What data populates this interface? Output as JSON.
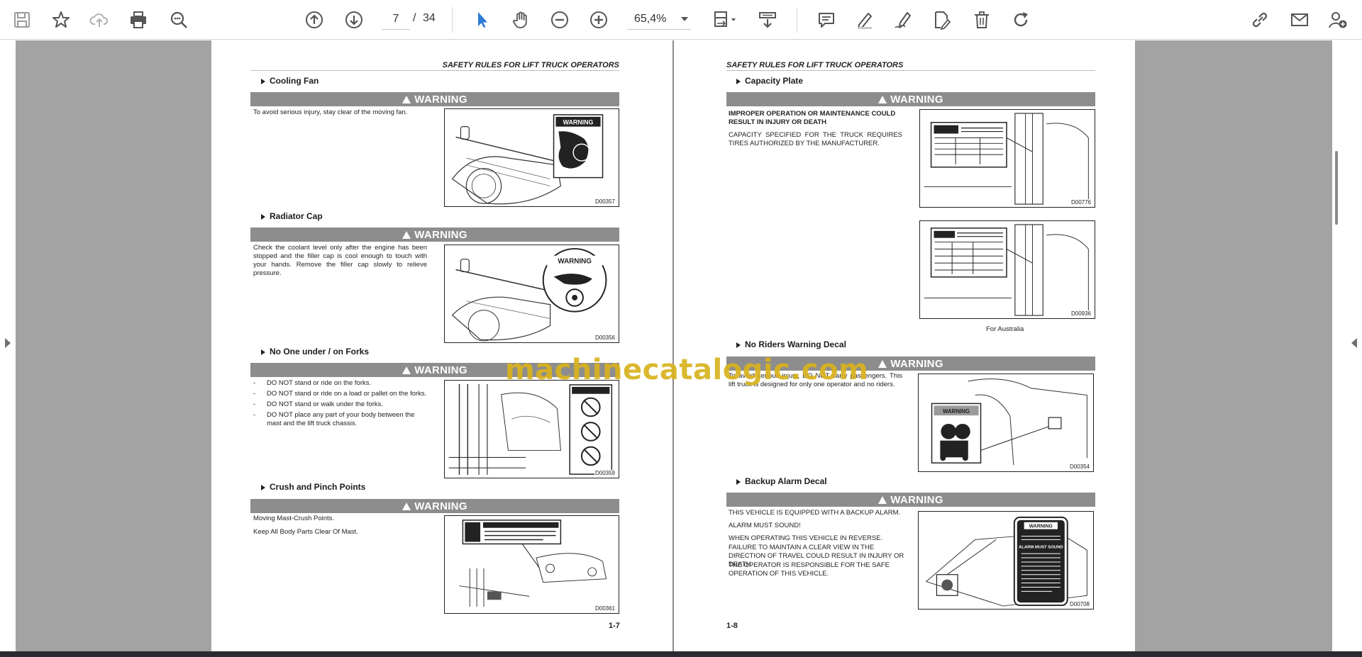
{
  "toolbar": {
    "page_current": "7",
    "page_separator": "/",
    "page_total": "34",
    "zoom": "65,4%"
  },
  "colors": {
    "accent": "#2d7bd6",
    "warning_bar": "#8d8d8d",
    "watermark": "#d9b21e"
  },
  "left_page": {
    "header": "SAFETY RULES FOR LIFT TRUCK OPERATORS",
    "page_number": "1-7",
    "sections": [
      {
        "title": "Cooling Fan",
        "warning": "WARNING",
        "text": "To avoid serious injury, stay clear of the moving fan.",
        "figure_code": "D00357",
        "decal_label": "WARNING"
      },
      {
        "title": "Radiator Cap",
        "warning": "WARNING",
        "text": "Check the coolant level only after the engine has been stopped and the filler cap is cool enough to touch with your hands. Remove the filler cap slowly to relieve pressure.",
        "figure_code": "D00356",
        "decal_label": "WARNING"
      },
      {
        "title": "No One under / on Forks",
        "warning": "WARNING",
        "bullets": [
          "DO NOT stand or ride on the forks.",
          "DO NOT stand or ride on a load or pallet on the forks.",
          "DO NOT stand or walk under the forks.",
          "DO NOT place any part of your body between the mast and the lift truck chassis."
        ],
        "bullet_marker": "-",
        "figure_code": "D00359"
      },
      {
        "title": "Crush and Pinch Points",
        "warning": "WARNING",
        "lines": [
          "Moving Mast-Crush Points.",
          "Keep All Body Parts Clear Of Mast."
        ],
        "figure_code": "D00361"
      }
    ]
  },
  "right_page": {
    "header": "SAFETY RULES FOR LIFT TRUCK OPERATORS",
    "page_number": "1-8",
    "sections": [
      {
        "title": "Capacity Plate",
        "warning": "WARNING",
        "bold_text": "IMPROPER OPERATION OR MAINTENANCE COULD RESULT IN INJURY OR DEATH",
        "text": "CAPACITY SPECIFIED FOR THE TRUCK REQUIRES TIRES AUTHORIZED BY THE MANUFACTURER.",
        "figure_code": "D00776",
        "figure2_code": "D00936",
        "caption": "For Australia"
      },
      {
        "title": "No Riders Warning Decal",
        "warning": "WARNING",
        "text": "To avoid serious injury, DO NOT carry passengers. This lift truck is designed for only one operator and no riders.",
        "figure_code": "D00354",
        "decal_label": "WARNING"
      },
      {
        "title": "Backup Alarm Decal",
        "warning": "WARNING",
        "lines": [
          "THIS VEHICLE IS EQUIPPED WITH A BACKUP ALARM.",
          "ALARM MUST SOUND!",
          "WHEN OPERATING THIS VEHICLE IN REVERSE.",
          "FAILURE TO MAINTAIN A CLEAR VIEW IN THE DIRECTION OF TRAVEL COULD RESULT IN INJURY OR DEATH.",
          "THE OPERATOR IS RESPONSIBLE FOR THE SAFE OPERATION OF THIS VEHICLE."
        ],
        "figure_code": "D00708",
        "decal_label": "WARNING",
        "decal_text": "ALARM MUST SOUND"
      }
    ]
  },
  "watermark": "machinecatalogic.com"
}
